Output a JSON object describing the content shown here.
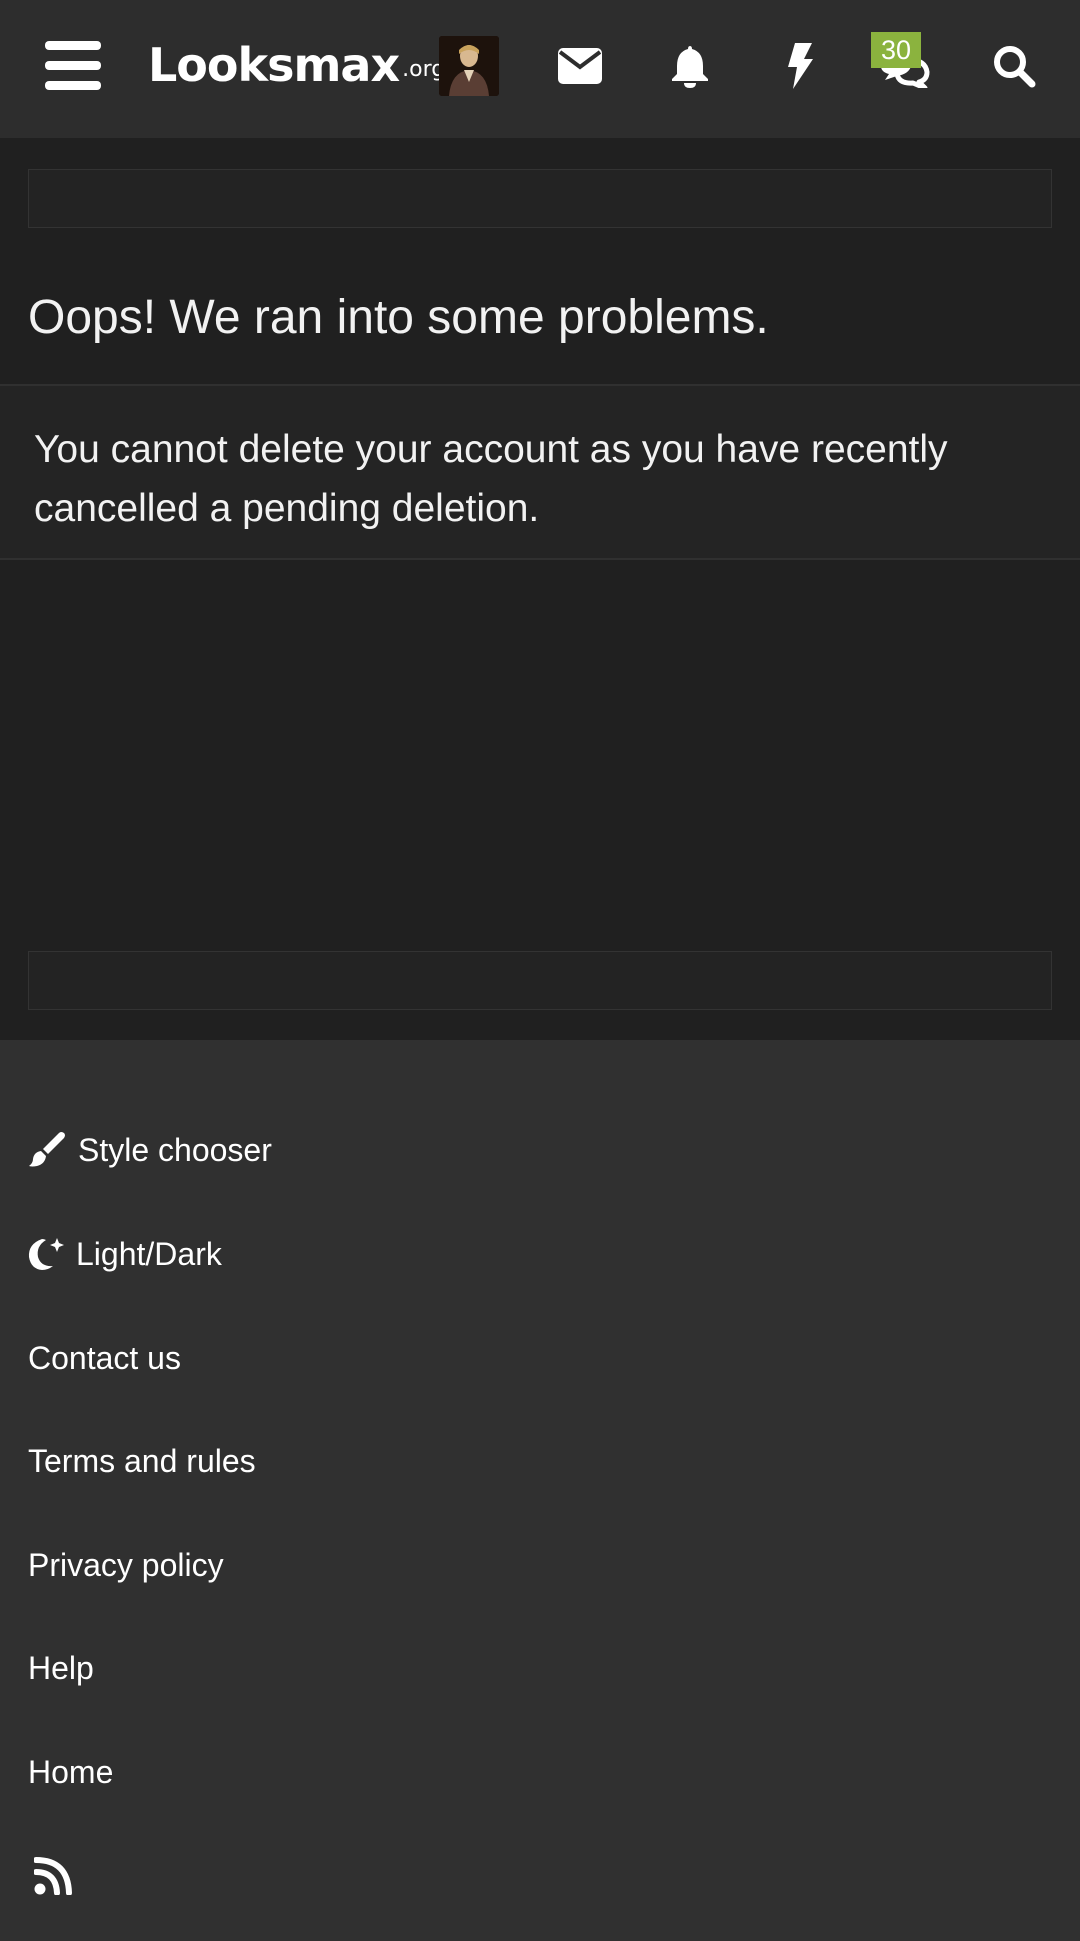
{
  "header": {
    "logo_main": "Looksmax",
    "logo_tld": ".org",
    "chat_badge": "30",
    "icons": [
      "menu-icon",
      "envelope-icon",
      "bell-icon",
      "bolt-icon",
      "chat-bubbles-icon",
      "search-icon"
    ],
    "badge_color": "#8bb33e"
  },
  "main": {
    "title": "Oops! We ran into some problems.",
    "error_message": "You cannot delete your account as you have recently cancelled a pending deletion."
  },
  "footer": {
    "style_chooser": "Style chooser",
    "light_dark": "Light/Dark",
    "contact": "Contact us",
    "terms": "Terms and rules",
    "privacy": "Privacy policy",
    "help": "Help",
    "home": "Home",
    "icons": [
      "paintbrush-icon",
      "moon-icon",
      "rss-icon"
    ]
  },
  "colors": {
    "header_bg": "#2d2d2d",
    "main_bg": "#202020",
    "footer_bg": "#303030",
    "text": "#ffffff"
  }
}
